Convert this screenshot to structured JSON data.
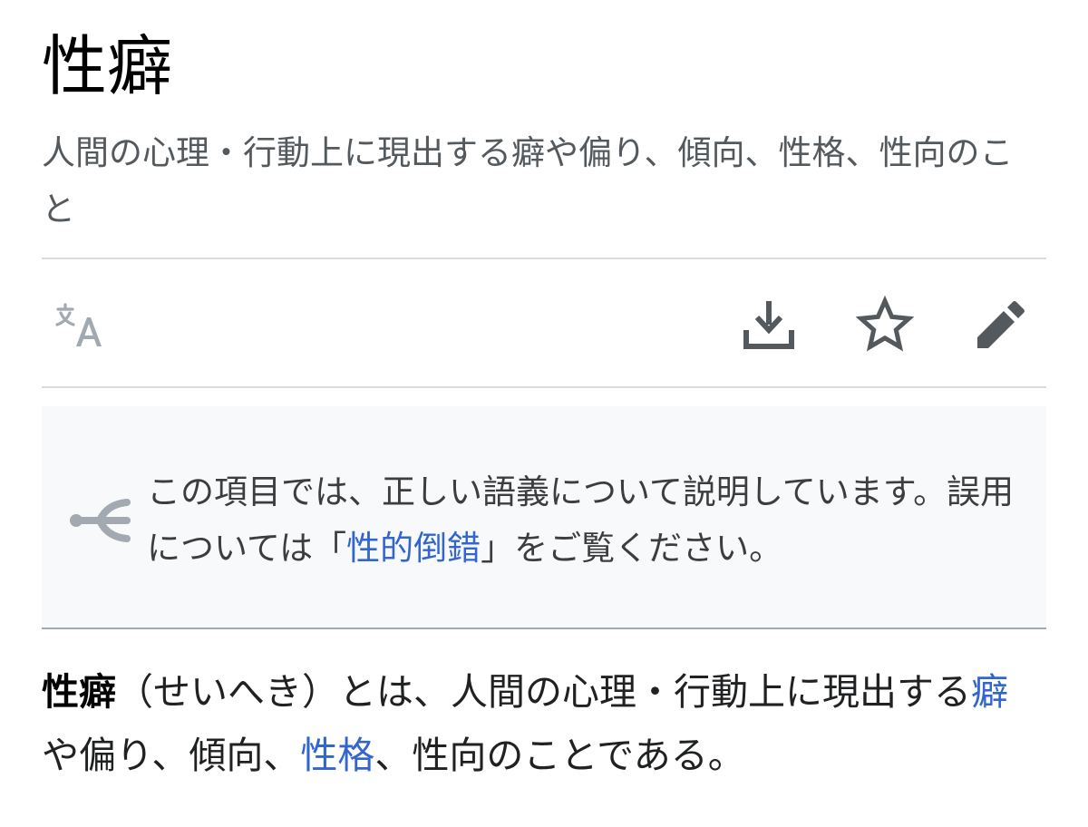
{
  "article": {
    "title": "性癖",
    "short_description": "人間の心理・行動上に現出する癖や偏り、傾向、性格、性向のこと"
  },
  "toolbar": {
    "language_icon": "language-translate-icon",
    "download_icon": "download-icon",
    "watch_icon": "star-icon",
    "edit_icon": "pencil-edit-icon"
  },
  "hatnote": {
    "icon": "disambiguation-arrows-icon",
    "text_before": "この項目では、正しい語義について説明しています。誤用については「",
    "link_text": "性的倒錯",
    "text_after": "」をご覧ください。"
  },
  "intro": {
    "term": "性癖",
    "reading": "（せいへき）とは、人間の心理・行動上に現出する",
    "link1": "癖",
    "text_mid": "や偏り、傾向、",
    "link2": "性格",
    "text_end": "、性向のことである。"
  },
  "colors": {
    "link": "#3366cc",
    "text": "#202122",
    "muted": "#54595d",
    "hatnote_bg": "#f8f9fa"
  }
}
